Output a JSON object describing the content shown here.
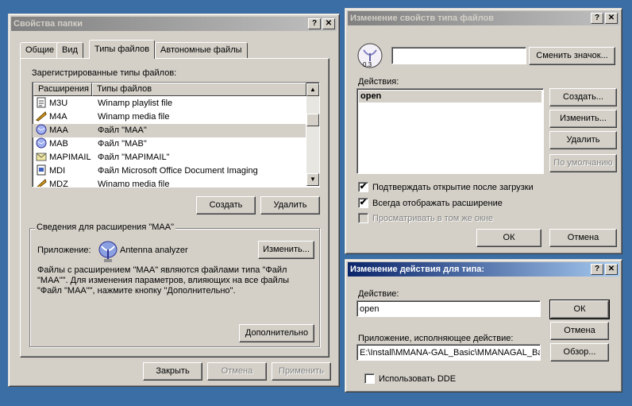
{
  "folder_options": {
    "title": "Свойства папки",
    "help": "?",
    "close": "✕",
    "tabs": [
      "Общие",
      "Вид",
      "Типы файлов",
      "Автономные файлы"
    ],
    "registered_label": "Зарегистрированные типы файлов:",
    "columns": [
      "Расширения",
      "Типы файлов"
    ],
    "rows": [
      {
        "ext": "M3U",
        "type": "Winamp playlist file",
        "icon": "playlist-file-icon"
      },
      {
        "ext": "M4A",
        "type": "Winamp media file",
        "icon": "winamp-file-icon"
      },
      {
        "ext": "MAA",
        "type": "Файл \"MAA\"",
        "icon": "antenna-file-icon"
      },
      {
        "ext": "MAB",
        "type": "Файл \"MAB\"",
        "icon": "antenna-file-icon"
      },
      {
        "ext": "MAPIMAIL",
        "type": "Файл \"MAPIMAIL\"",
        "icon": "mail-file-icon"
      },
      {
        "ext": "MDI",
        "type": "Файл Microsoft Office Document Imaging",
        "icon": "document-file-icon"
      },
      {
        "ext": "MDZ",
        "type": "Winamp media file",
        "icon": "winamp-file-icon"
      }
    ],
    "create_button": "Создать",
    "delete_button": "Удалить",
    "details_title": "Сведения для расширения \"MAA\"",
    "app_label": "Приложение:",
    "app_name": "Antenna analyzer",
    "change_button": "Изменить...",
    "description": "Файлы с расширением \"MAA\" являются файлами типа \"Файл \"MAA\"\". Для изменения параметров, влияющих на все файлы \"Файл \"MAA\"\", нажмите кнопку \"Дополнительно\".",
    "advanced_button": "Дополнительно",
    "close_button": "Закрыть",
    "cancel_button": "Отмена",
    "apply_button": "Применить"
  },
  "edit_type": {
    "title": "Изменение свойств типа файлов",
    "help": "?",
    "close": "✕",
    "icon_caption": "0.3",
    "name_value": "",
    "change_icon_button": "Сменить значок...",
    "actions_label": "Действия:",
    "actions": [
      "open"
    ],
    "new_button": "Создать...",
    "edit_button": "Изменить...",
    "remove_button": "Удалить",
    "default_button": "По умолчанию",
    "confirm_open": "Подтверждать открытие после загрузки",
    "always_show_ext": "Всегда отображать расширение",
    "browse_same_window": "Просматривать в том же окне",
    "confirm_open_checked": true,
    "always_show_ext_checked": true,
    "browse_same_window_checked": false,
    "ok_button": "ОК",
    "cancel_button": "Отмена"
  },
  "edit_action": {
    "title": "Изменение действия для типа:",
    "help": "?",
    "close": "✕",
    "action_label": "Действие:",
    "action_value": "open",
    "app_label": "Приложение, исполняющее действие:",
    "app_value": "E:\\Install\\MMANA-GAL_Basic\\MMANAGAL_Basi",
    "ok_button": "ОК",
    "cancel_button": "Отмена",
    "browse_button": "Обзор...",
    "use_dde": "Использовать DDE",
    "use_dde_checked": false
  },
  "colors": {
    "desktop": "#3a6ea5",
    "face": "#d4d0c8",
    "active_title": "#0a246a",
    "inactive_title": "#808080"
  }
}
